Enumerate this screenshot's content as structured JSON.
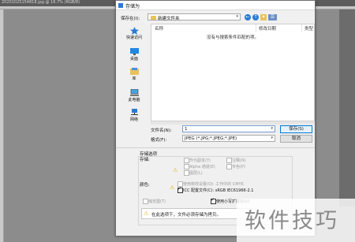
{
  "background_app": {
    "doc_title": "20201025154818.jpg @ 16.7% (RGB/8)"
  },
  "dialog": {
    "title": "存储为",
    "save_in_label": "保存在(I):",
    "current_folder": "新建文件夹",
    "nav": [
      {
        "label": "快速访问",
        "icon": "quick-access-star-icon"
      },
      {
        "label": "桌面",
        "icon": "desktop-icon"
      },
      {
        "label": "库",
        "icon": "library-icon"
      },
      {
        "label": "此电脑",
        "icon": "computer-icon"
      },
      {
        "label": "网络",
        "icon": "network-icon"
      }
    ],
    "file_list": {
      "col_name": "名称",
      "col_date": "修改日期",
      "col_type": "类型",
      "empty_message": "没有与搜索条件匹配的项。"
    },
    "filename_label": "文件名(N):",
    "filename_value": "1",
    "format_label": "格式(F):",
    "format_value": "JPEG (*.JPG;*.JPEG;*.JPE)",
    "save_button": "保存(S)",
    "cancel_button": "取消",
    "options": {
      "section_title": "存储选项",
      "store_label": "存储:",
      "as_copy": "作为副本(Y)",
      "notes": "注释(N)",
      "alpha": "Alpha 通道(E)",
      "spot": "专色(P)",
      "layers": "图层(L)",
      "color_label": "颜色:",
      "proof": "使用校样设置(O): 工作中的 CMYK",
      "icc": "ICC 配置文件(C): sRGB IEC61966-2.1",
      "thumbnail": "缩览图(T)",
      "lowercase_ext": "使用小写扩展名(U)",
      "alert": "在此选项下，文件必须存储为拷贝。"
    }
  },
  "watermark": "软件技巧",
  "colors": {
    "accent": "#0078d7",
    "warning": "#e0b000",
    "folder": "#e7c35a"
  }
}
